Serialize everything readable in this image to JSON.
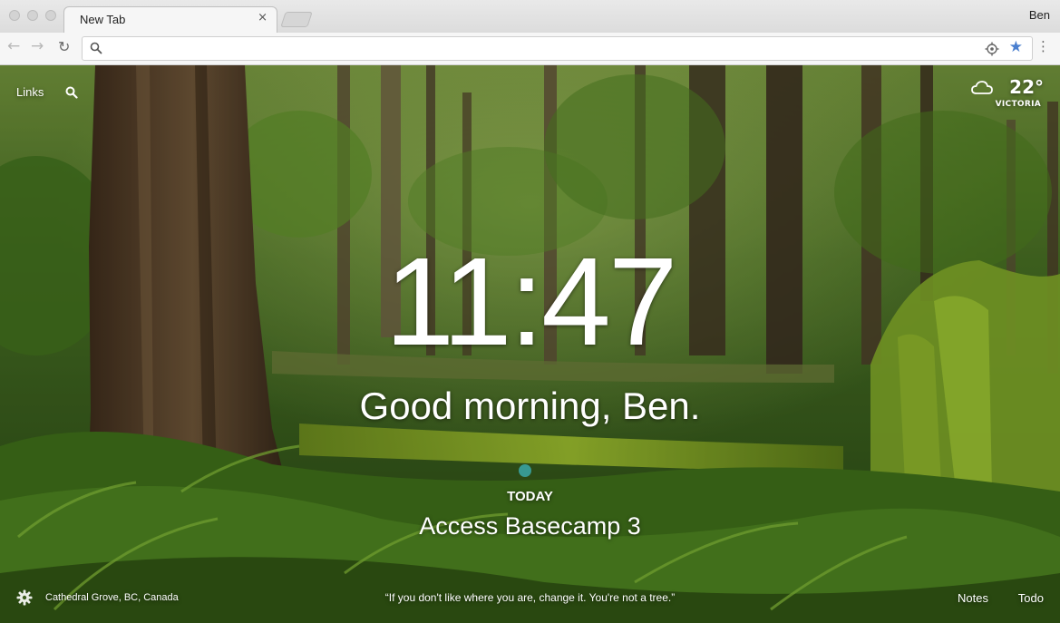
{
  "browser": {
    "tab_title": "New Tab",
    "tab_close_glyph": "×",
    "profile_name": "Ben",
    "address_value": "",
    "back_glyph": "←",
    "forward_glyph": "→",
    "reload_glyph": "↻",
    "star_glyph": "★",
    "menu_glyph": "⋮"
  },
  "dashboard": {
    "links_label": "Links",
    "weather": {
      "temperature": "22°",
      "city": "VICTORIA"
    },
    "clock": "11:47",
    "greeting": "Good morning, Ben.",
    "focus": {
      "heading": "TODAY",
      "text": "Access Basecamp 3"
    },
    "photo_location": "Cathedral Grove, BC, Canada",
    "quote": "“If you don't like where you are, change it. You're not a tree.”",
    "notes_label": "Notes",
    "todo_label": "Todo"
  },
  "colors": {
    "focus_dot": "#3aa2a0",
    "star": "#4a7fcf"
  }
}
